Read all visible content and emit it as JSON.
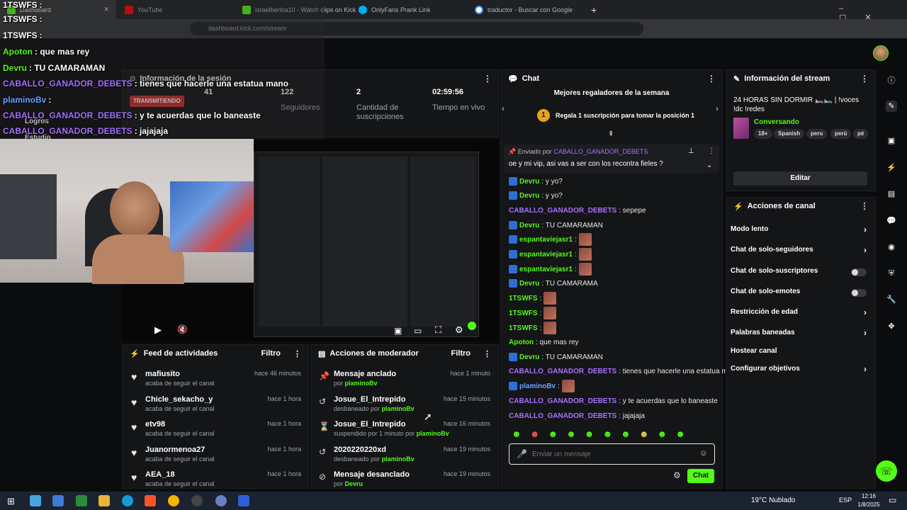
{
  "browser": {
    "tabs": [
      "Dashboard",
      "YouTube",
      "israelbenba10 - Watch clips on Kick",
      "OnlyFans Prank Link",
      "traductor - Buscar con Google"
    ],
    "new_tab": "+",
    "url": "dashboard.kick.com/stream"
  },
  "overlay_chat": [
    {
      "user": "1TSWFS",
      "text": ":",
      "color": "#ffffff"
    },
    {
      "user": "1TSWFS",
      "text": ":",
      "color": "#ffffff"
    },
    {
      "user": "1TSWFS",
      "text": ":",
      "color": "#ffffff"
    },
    {
      "user": "Apoton",
      "text": ": que mas rey",
      "color": "#53fc18"
    },
    {
      "user": "Devru",
      "text": ": TU CAMARAMAN",
      "color": "#53fc18"
    },
    {
      "user": "CABALLO_GANADOR_DEBETS",
      "text": ": tienes que hacerle una estatua mano",
      "color": "#a970ff"
    },
    {
      "user": "plaminoBv",
      "text": ":",
      "color": "#6aa2ff"
    },
    {
      "user": "CABALLO_GANADOR_DEBETS",
      "text": ": y te acuerdas que lo baneaste",
      "color": "#a970ff"
    },
    {
      "user": "CABALLO_GANADOR_DEBETS",
      "text": ": jajajaja",
      "color": "#a970ff"
    }
  ],
  "session": {
    "title": "Información de la sesión",
    "status": "TRANSMITIENDO",
    "stats": [
      {
        "value": "41",
        "label": ""
      },
      {
        "value": "122",
        "label": "Seguidores"
      },
      {
        "value": "2",
        "label": "Cantidad de suscripciones"
      },
      {
        "value": "02:59:56",
        "label": "Tiempo en vivo"
      }
    ],
    "side_labels": [
      "Logros",
      "Estudio"
    ]
  },
  "feed": {
    "title": "Feed de actividades",
    "filter": "Filtro",
    "items": [
      {
        "name": "mafiusito",
        "sub": "acaba de seguir el canal",
        "time": "hace 46 minutos"
      },
      {
        "name": "Chicle_sekacho_y",
        "sub": "acaba de seguir el canal",
        "time": "hace 1 hora"
      },
      {
        "name": "etv98",
        "sub": "acaba de seguir el canal",
        "time": "hace 1 hora"
      },
      {
        "name": "Juanormenoa27",
        "sub": "acaba de seguir el canal",
        "time": "hace 1 hora"
      },
      {
        "name": "AEA_18",
        "sub": "acaba de seguir el canal",
        "time": "hace 1 hora"
      }
    ]
  },
  "mod": {
    "title": "Acciones de moderador",
    "filter": "Filtro",
    "items": [
      {
        "icon": "pin-icon",
        "glyph": "📌",
        "name": "Mensaje anclado",
        "sub": "por ",
        "by": "plaminoBv",
        "time": "hace 1 minuto"
      },
      {
        "icon": "unban-icon",
        "glyph": "↺",
        "name": "Josue_El_Intrepido",
        "sub": "desbaneado por ",
        "by": "plaminoBv",
        "time": "hace 15 minutos"
      },
      {
        "icon": "hourglass-icon",
        "glyph": "⌛",
        "name": "Josue_El_Intrepido",
        "sub": "suspendido por 1 minuto por ",
        "by": "plaminoBv",
        "time": "hace 16 minutos"
      },
      {
        "icon": "unban-icon",
        "glyph": "↺",
        "name": "2020220220xd",
        "sub": "desbaneado por ",
        "by": "plaminoBv",
        "time": "hace 19 minutos"
      },
      {
        "icon": "unpin-icon",
        "glyph": "⊘",
        "name": "Mensaje desanclado",
        "sub": "por ",
        "by": "Devru",
        "time": "hace 19 minutos"
      }
    ]
  },
  "chat": {
    "title": "Chat",
    "gifters_title": "Mejores regaladores de la semana",
    "gift_rank": "1",
    "gift_cta": "Regala 1 suscripción para tomar la posición 1",
    "pinned_by_label": "Enviado por",
    "pinned_by_user": "CABALLO_GANADOR_DEBETS",
    "pinned_text": "oe y mi vip, asi vas a ser con los recontra fieles ?",
    "messages": [
      {
        "user": "Devru",
        "text": ": y yo?",
        "color": "#53fc18",
        "badge": true,
        "emote": false
      },
      {
        "user": "Devru",
        "text": ": y yo?",
        "color": "#53fc18",
        "badge": true,
        "emote": false
      },
      {
        "user": "CABALLO_GANADOR_DEBETS",
        "text": ": sepepe",
        "color": "#a970ff",
        "badge": false,
        "emote": false
      },
      {
        "user": "Devru",
        "text": ": TU CAMARAMAN",
        "color": "#53fc18",
        "badge": true,
        "emote": false
      },
      {
        "user": "espantaviejasr1",
        "text": ":",
        "color": "#53fc18",
        "badge": true,
        "emote": true
      },
      {
        "user": "espantaviejasr1",
        "text": ":",
        "color": "#53fc18",
        "badge": true,
        "emote": true
      },
      {
        "user": "espantaviejasr1",
        "text": ":",
        "color": "#53fc18",
        "badge": true,
        "emote": true
      },
      {
        "user": "Devru",
        "text": ": TU CAMARAMA",
        "color": "#53fc18",
        "badge": true,
        "emote": false
      },
      {
        "user": "1TSWFS",
        "text": ":",
        "color": "#53fc18",
        "badge": false,
        "emote": true
      },
      {
        "user": "1TSWFS",
        "text": ":",
        "color": "#53fc18",
        "badge": false,
        "emote": true
      },
      {
        "user": "1TSWFS",
        "text": ":",
        "color": "#53fc18",
        "badge": false,
        "emote": true
      },
      {
        "user": "Apoton",
        "text": ": que mas rey",
        "color": "#53fc18",
        "badge": false,
        "emote": false
      },
      {
        "user": "Devru",
        "text": ": TU CAMARAMAN",
        "color": "#53fc18",
        "badge": true,
        "emote": false
      },
      {
        "user": "CABALLO_GANADOR_DEBETS",
        "text": ": tienes que hacerle una estatua mano",
        "color": "#a970ff",
        "badge": false,
        "emote": false
      },
      {
        "user": "plaminoBv",
        "text": ":",
        "color": "#6aa2ff",
        "badge": true,
        "emote": true
      },
      {
        "user": "CABALLO_GANADOR_DEBETS",
        "text": ": y te acuerdas que lo baneaste",
        "color": "#a970ff",
        "badge": false,
        "emote": false
      },
      {
        "user": "CABALLO_GANADOR_DEBETS",
        "text": ": jajajaja",
        "color": "#a970ff",
        "badge": false,
        "emote": false
      }
    ],
    "input_placeholder": "Enviar un mensaje",
    "send_label": "Chat"
  },
  "stream_info": {
    "title": "Información del stream",
    "stream_title": "24 HORAS SIN DORMIR 🛏️🛏️ | !voces !dc !redes",
    "category": "Conversando",
    "tags": [
      "18+",
      "Spanish",
      "peru",
      "perú",
      "pé"
    ],
    "edit_label": "Editar"
  },
  "channel_actions": {
    "title": "Acciones de canal",
    "items": [
      {
        "label": "Modo lento",
        "control": "chevron"
      },
      {
        "label": "Chat de solo-seguidores",
        "control": "chevron"
      },
      {
        "label": "Chat de solo-suscriptores",
        "control": "toggle"
      },
      {
        "label": "Chat de solo-emotes",
        "control": "toggle"
      },
      {
        "label": "Restricción de edad",
        "control": "chevron"
      },
      {
        "label": "Palabras baneadas",
        "control": "chevron"
      },
      {
        "label": "Hostear canal",
        "control": "none"
      },
      {
        "label": "Configurar objetivos",
        "control": "chevron"
      }
    ]
  },
  "taskbar": {
    "weather": "19°C Nublado",
    "lang": "ESP",
    "time": "12:16",
    "date": "1/8/2025"
  },
  "colors": {
    "accent": "#53fc18",
    "purple": "#a970ff",
    "panel": "#141517"
  }
}
